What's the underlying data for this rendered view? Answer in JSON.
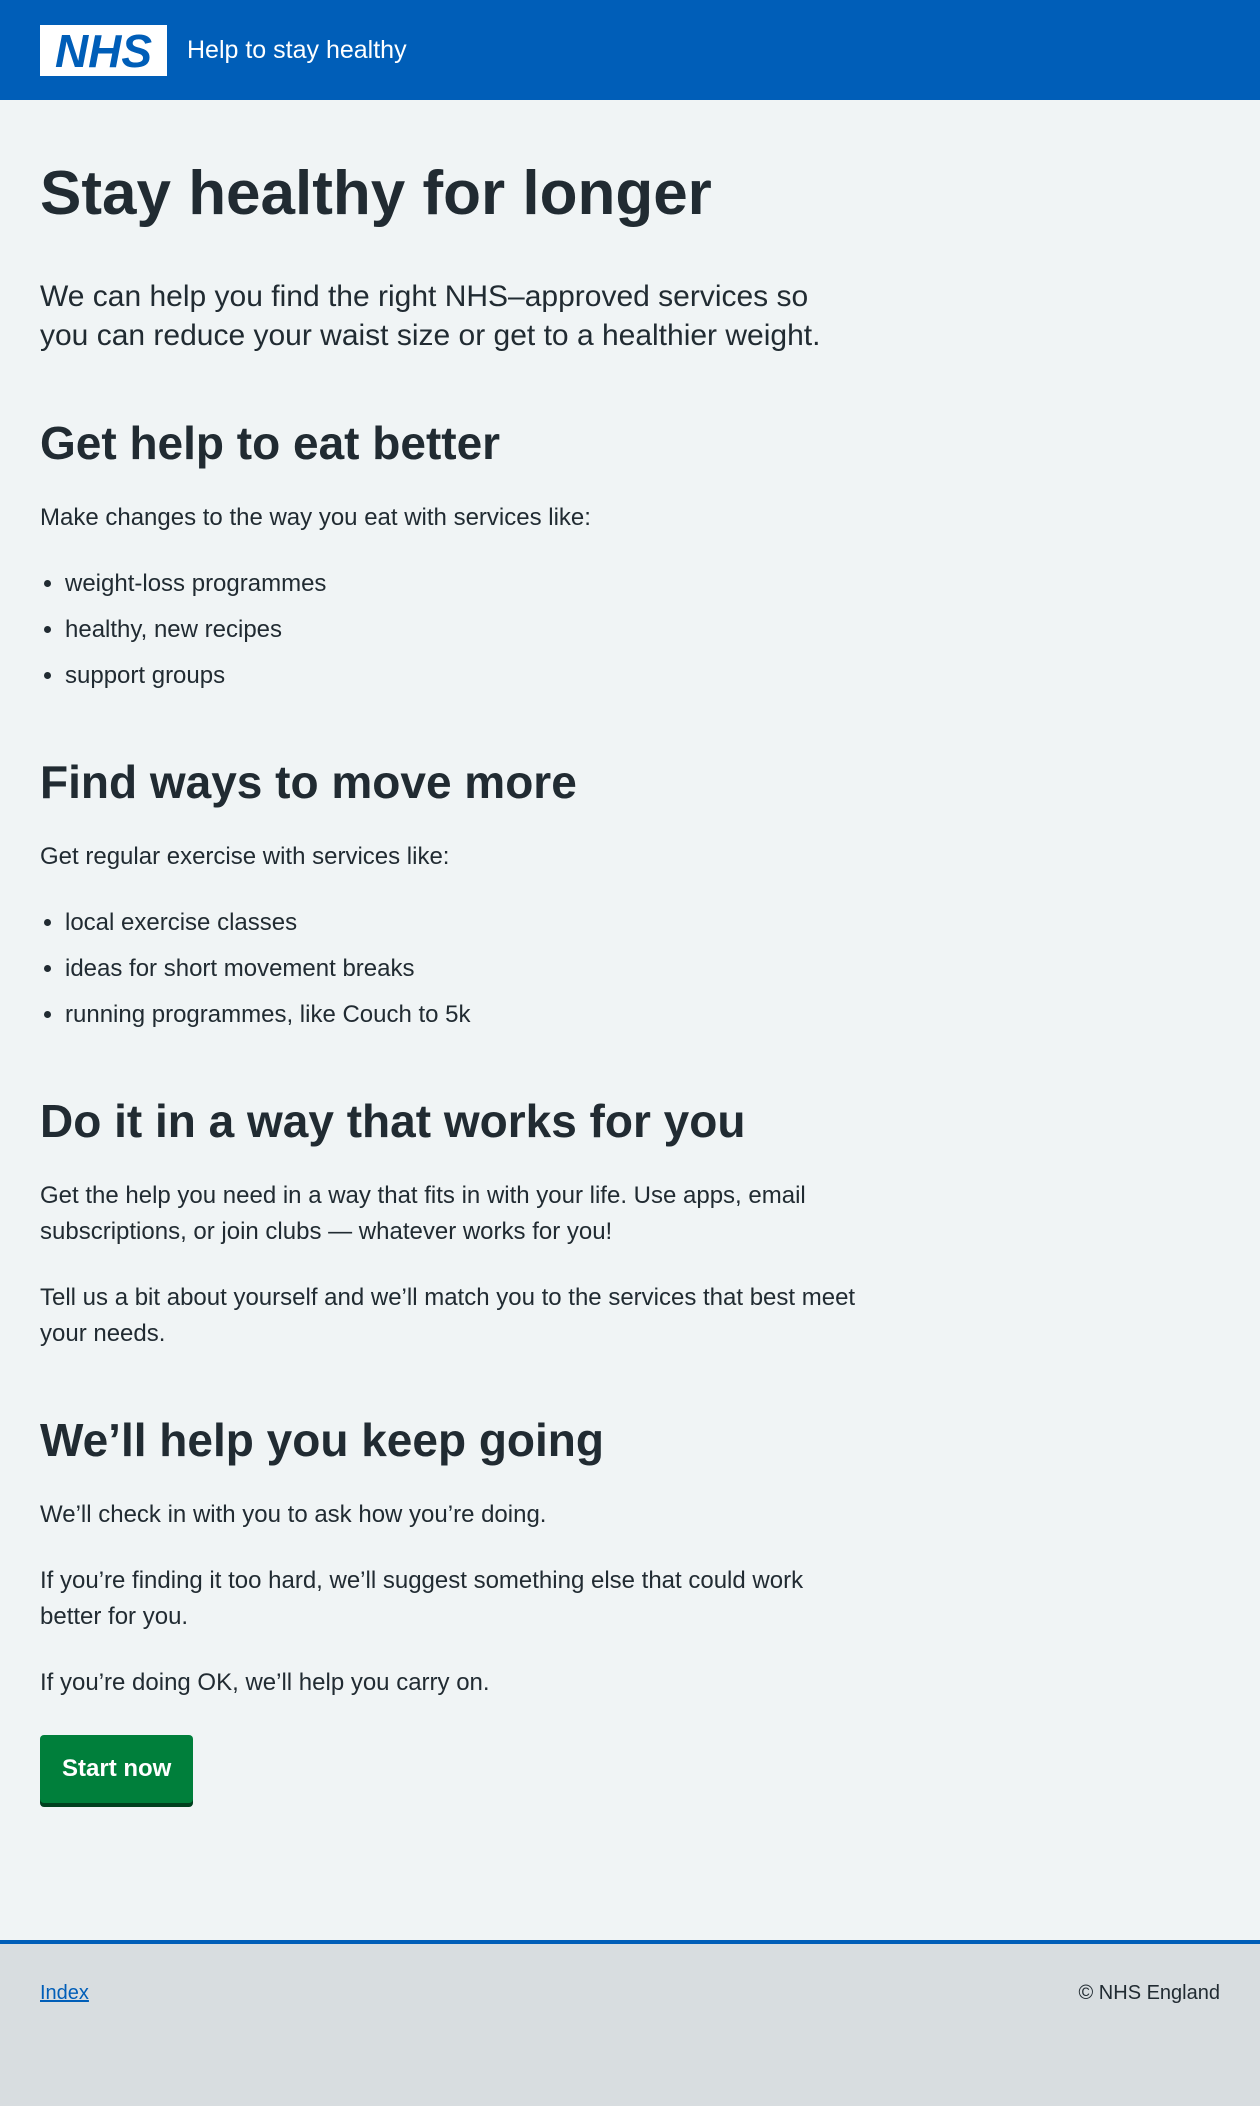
{
  "header": {
    "logo_text": "NHS",
    "service_name": "Help to stay healthy",
    "brand_color": "#005eb8"
  },
  "main": {
    "title": "Stay healthy for longer",
    "lead": "We can help you find the right NHS–approved services so you can reduce your waist size or get to a healthier weight.",
    "sections": [
      {
        "heading": "Get help to eat better",
        "paragraphs": [
          "Make changes to the way you eat with services like:"
        ],
        "bullets": [
          "weight-loss programmes",
          "healthy, new recipes",
          "support groups"
        ]
      },
      {
        "heading": "Find ways to move more",
        "paragraphs": [
          "Get regular exercise with services like:"
        ],
        "bullets": [
          "local exercise classes",
          "ideas for short movement breaks",
          "running programmes, like Couch to 5k"
        ]
      },
      {
        "heading": "Do it in a way that works for you",
        "paragraphs": [
          "Get the help you need in a way that fits in with your life. Use apps, email subscriptions, or join clubs — whatever works for you!",
          "Tell us a bit about yourself and we’ll match you to the services that best meet your needs."
        ]
      },
      {
        "heading": "We’ll help you keep going",
        "paragraphs": [
          "We’ll check in with you to ask how you’re doing.",
          "If you’re finding it too hard, we’ll suggest something else that could work better for you.",
          "If you’re doing OK, we’ll help you carry on."
        ]
      }
    ],
    "start_button": "Start now",
    "start_button_color": "#007f3b"
  },
  "footer": {
    "index_link": "Index",
    "copyright": "© NHS England"
  }
}
